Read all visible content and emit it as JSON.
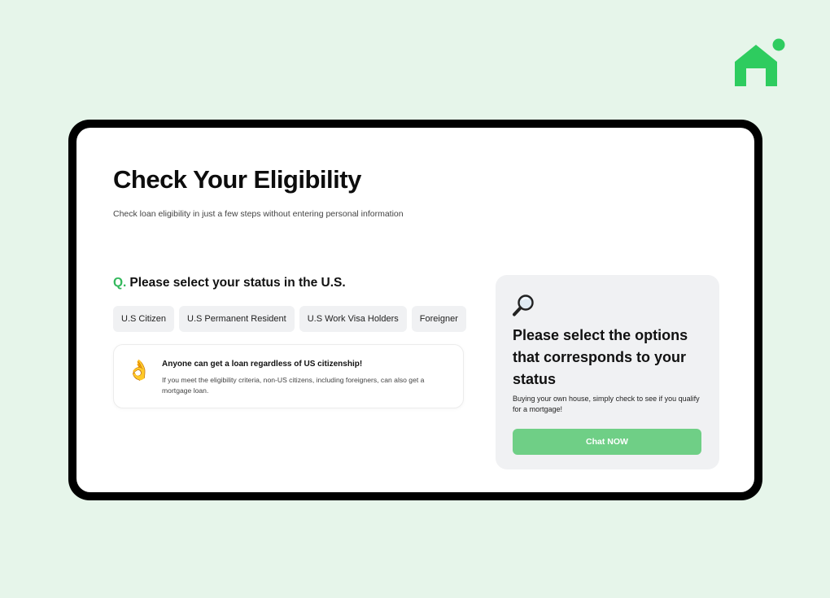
{
  "brand": {
    "logo_icon": "house-icon",
    "logo_color": "#2ecc5f"
  },
  "page": {
    "title": "Check Your Eligibility",
    "subtitle": "Check loan eligibility in just a few steps without entering personal information"
  },
  "question": {
    "prefix": "Q.",
    "text": "Please select your status in the U.S.",
    "options": [
      {
        "label": "U.S Citizen"
      },
      {
        "label": "U.S Permanent Resident"
      },
      {
        "label": "U.S Work Visa Holders"
      },
      {
        "label": "Foreigner"
      }
    ]
  },
  "info": {
    "icon": "ok-hand-icon",
    "emoji": "👌",
    "title": "Anyone can get a loan regardless of US citizenship!",
    "body": "If you meet the eligibility criteria, non-US citizens, including foreigners, can also get a mortgage loan."
  },
  "side_panel": {
    "icon": "magnifier-icon",
    "title": "Please select the options that corresponds to your status",
    "description": "Buying your own house, simply check to see if you qualify for a mortgage!",
    "button_label": "Chat NOW"
  },
  "colors": {
    "background": "#e6f5ea",
    "accent": "#33b85c",
    "button": "#6fcf86",
    "option_bg": "#f0f1f3"
  }
}
